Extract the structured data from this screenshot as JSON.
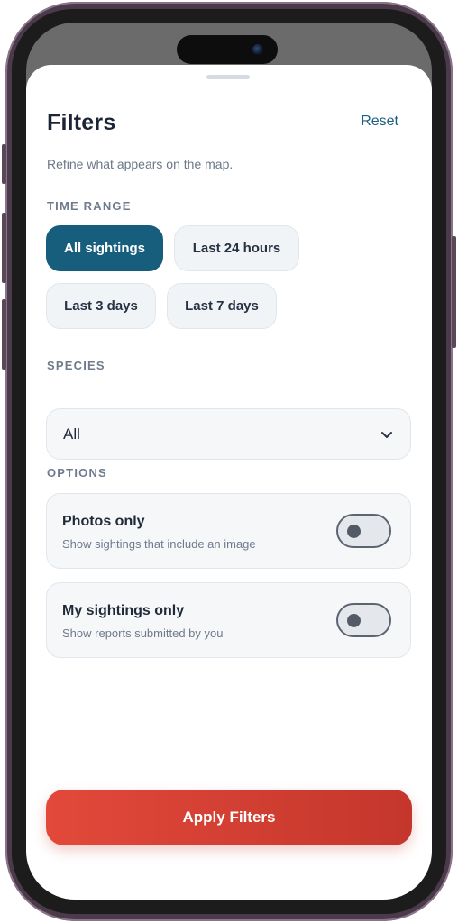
{
  "sheet": {
    "title": "Filters",
    "reset_label": "Reset",
    "subtitle": "Refine what appears on the map."
  },
  "time_range": {
    "label": "TIME RANGE",
    "options": [
      "All sightings",
      "Last 24 hours",
      "Last 3 days",
      "Last 7 days"
    ],
    "selected": "All sightings"
  },
  "species": {
    "label": "SPECIES",
    "selected": "All",
    "icon": "chevron-down-icon"
  },
  "options": {
    "label": "OPTIONS",
    "items": [
      {
        "title": "Photos only",
        "description": "Show sightings that include an image",
        "enabled": false
      },
      {
        "title": "My sightings only",
        "description": "Show reports submitted by you",
        "enabled": false
      }
    ]
  },
  "apply_label": "Apply Filters",
  "colors": {
    "accent": "#175d7c",
    "primary_button_start": "#e2493a",
    "primary_button_end": "#c4362c",
    "link": "#1f5f85"
  }
}
